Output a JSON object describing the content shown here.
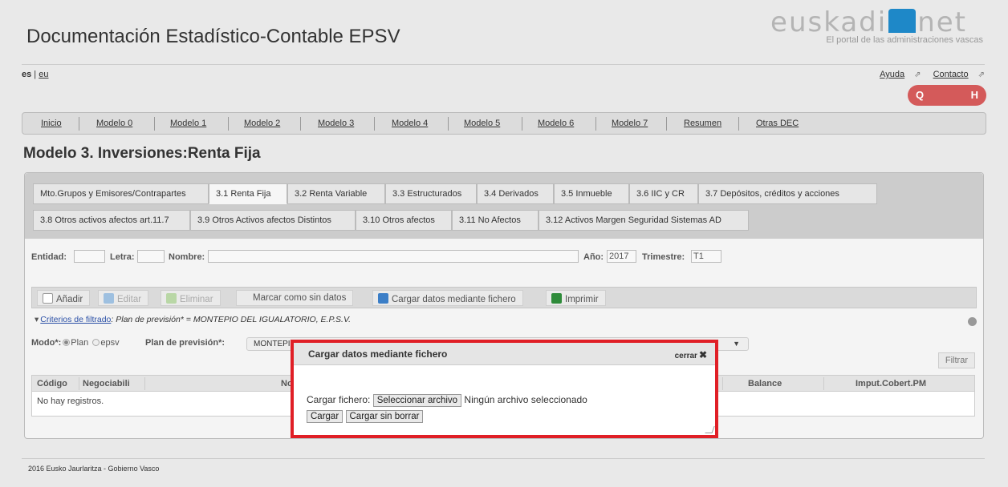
{
  "header": {
    "title": "Documentación Estadístico-Contable EPSV",
    "logo_text_a": "euskadi",
    "logo_text_b": "net",
    "logo_subtitle": "El portal de las administraciones vascas"
  },
  "lang": {
    "current": "es",
    "other": "eu"
  },
  "toplinks": {
    "help": "Ayuda",
    "contact": "Contacto"
  },
  "search": {
    "q": "Q",
    "h": "H"
  },
  "nav": [
    "Inicio",
    "Modelo 0",
    "Modelo 1",
    "Modelo 2",
    "Modelo 3",
    "Modelo 4",
    "Modelo 5",
    "Modelo 6",
    "Modelo 7",
    "Resumen",
    "Otras DEC"
  ],
  "section_title": "Modelo 3. Inversiones:Renta Fija",
  "tabs_row1": [
    "Mto.Grupos y Emisores/Contrapartes",
    "3.1 Renta Fija",
    "3.2 Renta Variable",
    "3.3 Estructurados",
    "3.4 Derivados",
    "3.5 Inmueble",
    "3.6 IIC y CR",
    "3.7 Depósitos, créditos y acciones"
  ],
  "tabs_row2": [
    "3.8 Otros activos afectos art.11.7",
    "3.9 Otros Activos afectos Distintos",
    "3.10 Otros afectos",
    "3.11 No Afectos",
    "3.12 Activos Margen Seguridad Sistemas AD"
  ],
  "filters": {
    "entidad_label": "Entidad:",
    "letra_label": "Letra:",
    "nombre_label": "Nombre:",
    "anio_label": "Año:",
    "anio_value": "2017",
    "trimestre_label": "Trimestre:",
    "trimestre_value": "T1"
  },
  "toolbar": {
    "add": "Añadir",
    "edit": "Editar",
    "delete": "Eliminar",
    "no_data": "Marcar como sin datos",
    "upload": "Cargar datos mediante fichero",
    "print": "Imprimir"
  },
  "criteria": {
    "link": "Criterios de filtrado",
    "text": ": Plan de previsión* = MONTEPIO DEL IGUALATORIO, E.P.S.V."
  },
  "modo": {
    "label": "Modo*:",
    "opt1": "Plan",
    "opt2": "epsv",
    "plan_label": "Plan de previsión*:",
    "plan_value": "MONTEPIO"
  },
  "filter_button": "Filtrar",
  "grid": {
    "columns": [
      "Código",
      "Negociabili",
      "No",
      "Balance",
      "Imput.Cobert.PM"
    ],
    "empty": "No hay registros."
  },
  "footer": "2016 Eusko Jaurlaritza - Gobierno Vasco",
  "dialog": {
    "title": "Cargar datos mediante fichero",
    "close": "cerrar",
    "file_label": "Cargar fichero:",
    "select_button": "Seleccionar archivo",
    "no_file": "Ningún archivo seleccionado",
    "load": "Cargar",
    "load_no_delete": "Cargar sin borrar"
  },
  "colors": {
    "accent_red": "#e01f26",
    "search_pill": "#d45a5a",
    "logo_blue": "#1e88c8"
  }
}
